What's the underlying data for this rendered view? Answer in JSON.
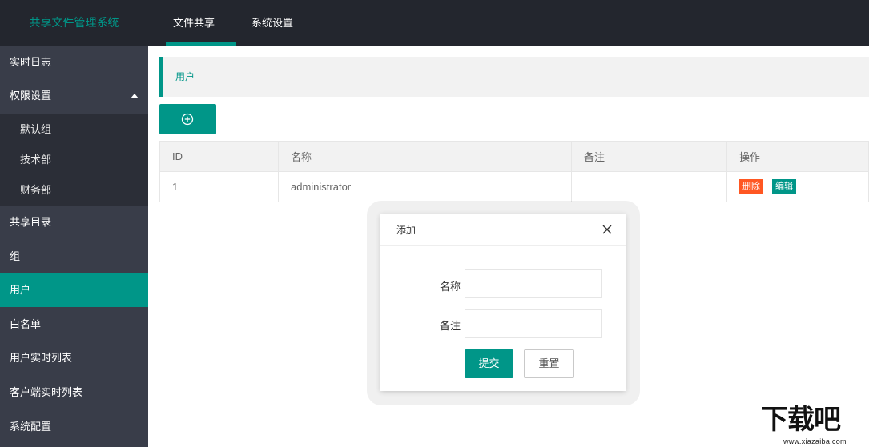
{
  "app": {
    "title": "共享文件管理系统"
  },
  "top_nav": [
    {
      "label": "文件共享"
    },
    {
      "label": "系统设置"
    }
  ],
  "sidebar": {
    "items": [
      {
        "label": "实时日志"
      },
      {
        "label": "权限设置"
      },
      {
        "label": "默认组"
      },
      {
        "label": "技术部"
      },
      {
        "label": "财务部"
      },
      {
        "label": "共享目录"
      },
      {
        "label": "组"
      },
      {
        "label": "用户"
      },
      {
        "label": "白名单"
      },
      {
        "label": "用户实时列表"
      },
      {
        "label": "客户端实时列表"
      },
      {
        "label": "系统配置"
      }
    ]
  },
  "breadcrumb": {
    "label": "用户"
  },
  "toolbar": {
    "add_icon": "plus-circle-icon"
  },
  "table": {
    "headers": [
      "ID",
      "名称",
      "备注",
      "操作"
    ],
    "rows": [
      {
        "id": "1",
        "name": "administrator",
        "note": "",
        "delete_label": "删除",
        "edit_label": "编辑"
      }
    ]
  },
  "modal": {
    "title": "添加",
    "close_icon": "close-icon",
    "name_label": "名称",
    "name_value": "",
    "note_label": "备注",
    "note_value": "",
    "submit_label": "提交",
    "reset_label": "重置"
  },
  "watermark": {
    "main": "下载吧",
    "sub": "www.xiazaiba.com"
  },
  "colors": {
    "accent": "#009688",
    "danger": "#ff5722",
    "header_bg": "#23262e",
    "sidebar_bg": "#393d49"
  }
}
